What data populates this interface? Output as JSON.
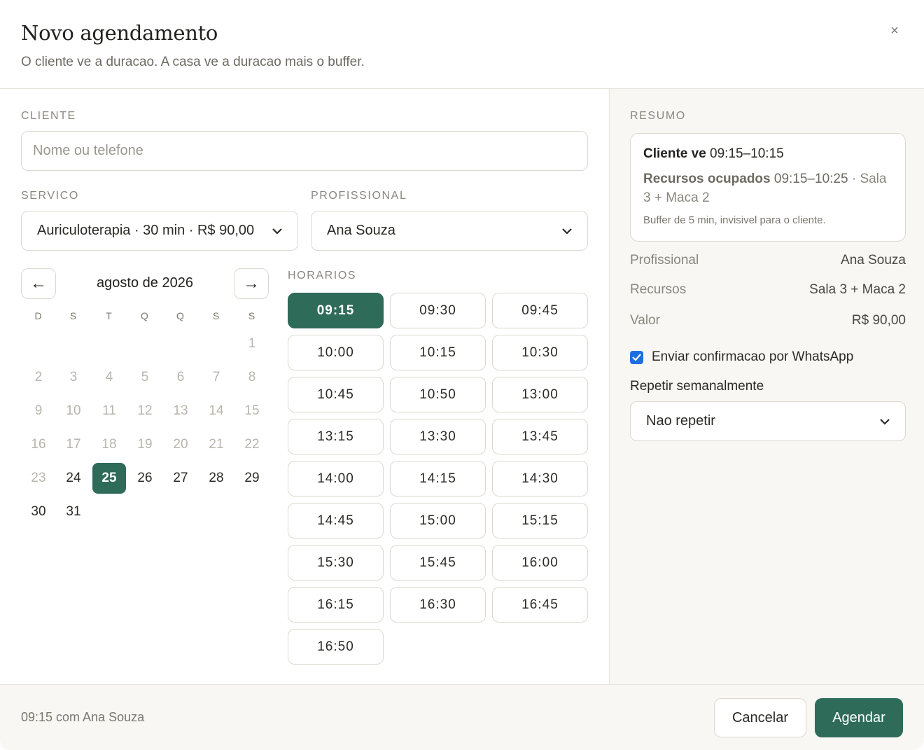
{
  "header": {
    "title": "Novo agendamento",
    "subtitle": "O cliente ve a duracao. A casa ve a duracao mais o buffer.",
    "close_icon": "×"
  },
  "cliente": {
    "label": "CLIENTE",
    "placeholder": "Nome ou telefone",
    "value": ""
  },
  "servico": {
    "label": "SERVICO",
    "selected": "Auriculoterapia · 30 min · R$ 90,00"
  },
  "profissional": {
    "label": "PROFISSIONAL",
    "selected": "Ana Souza"
  },
  "calendar": {
    "prev_icon": "←",
    "next_icon": "→",
    "month": "agosto de 2026",
    "weekdays": [
      "D",
      "S",
      "T",
      "Q",
      "Q",
      "S",
      "S"
    ],
    "selected_day": "25",
    "weeks": [
      [
        null,
        null,
        null,
        null,
        null,
        null,
        {
          "d": "1",
          "state": "muted"
        }
      ],
      [
        {
          "d": "2",
          "state": "muted"
        },
        {
          "d": "3",
          "state": "muted"
        },
        {
          "d": "4",
          "state": "muted"
        },
        {
          "d": "5",
          "state": "muted"
        },
        {
          "d": "6",
          "state": "muted"
        },
        {
          "d": "7",
          "state": "muted"
        },
        {
          "d": "8",
          "state": "muted"
        }
      ],
      [
        {
          "d": "9",
          "state": "muted"
        },
        {
          "d": "10",
          "state": "muted"
        },
        {
          "d": "11",
          "state": "muted"
        },
        {
          "d": "12",
          "state": "muted"
        },
        {
          "d": "13",
          "state": "muted"
        },
        {
          "d": "14",
          "state": "muted"
        },
        {
          "d": "15",
          "state": "muted"
        }
      ],
      [
        {
          "d": "16",
          "state": "muted"
        },
        {
          "d": "17",
          "state": "muted"
        },
        {
          "d": "18",
          "state": "muted"
        },
        {
          "d": "19",
          "state": "muted"
        },
        {
          "d": "20",
          "state": "muted"
        },
        {
          "d": "21",
          "state": "muted"
        },
        {
          "d": "22",
          "state": "muted"
        }
      ],
      [
        {
          "d": "23",
          "state": "muted"
        },
        {
          "d": "24",
          "state": "active"
        },
        {
          "d": "25",
          "state": "selected"
        },
        {
          "d": "26",
          "state": "active"
        },
        {
          "d": "27",
          "state": "active"
        },
        {
          "d": "28",
          "state": "active"
        },
        {
          "d": "29",
          "state": "active"
        }
      ],
      [
        {
          "d": "30",
          "state": "active"
        },
        {
          "d": "31",
          "state": "active"
        },
        null,
        null,
        null,
        null,
        null
      ]
    ]
  },
  "horarios": {
    "label": "HORARIOS",
    "selected": "09:15",
    "slots": [
      "09:15",
      "09:30",
      "09:45",
      "10:00",
      "10:15",
      "10:30",
      "10:45",
      "10:50",
      "13:00",
      "13:15",
      "13:30",
      "13:45",
      "14:00",
      "14:15",
      "14:30",
      "14:45",
      "15:00",
      "15:15",
      "15:30",
      "15:45",
      "16:00",
      "16:15",
      "16:30",
      "16:45",
      "16:50"
    ]
  },
  "resumo": {
    "label": "RESUMO",
    "cliente_ve_label": "Cliente ve",
    "cliente_ve_time": "09:15–10:15",
    "recursos_label": "Recursos ocupados",
    "recursos_time": "09:15–10:25",
    "recursos_rest": " · Sala 3 + Maca 2",
    "buffer_note": "Buffer de 5 min, invisivel para o cliente.",
    "rows": [
      {
        "key": "Profissional",
        "value": "Ana Souza"
      },
      {
        "key": "Recursos",
        "value": "Sala 3 + Maca 2"
      },
      {
        "key": "Valor",
        "value": "R$ 90,00"
      }
    ],
    "whatsapp_label": "Enviar confirmacao por WhatsApp",
    "whatsapp_checked": true,
    "repeat_label": "Repetir semanalmente",
    "repeat_selected": "Nao repetir"
  },
  "footer": {
    "info": "09:15 com Ana Souza",
    "cancel_label": "Cancelar",
    "submit_label": "Agendar"
  },
  "colors": {
    "accent": "#2f6b59",
    "checkbox": "#1d6fe0"
  }
}
